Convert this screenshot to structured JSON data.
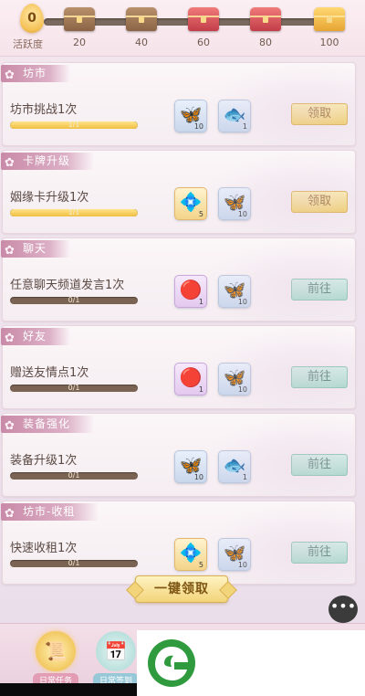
{
  "activity": {
    "label": "活跃度",
    "value": "0",
    "progress": 0,
    "milestones": [
      "20",
      "40",
      "60",
      "80",
      "100"
    ],
    "chest_types": [
      "wood",
      "wood",
      "red",
      "red",
      "gold"
    ]
  },
  "tasks": [
    {
      "category": "坊市",
      "title": "坊市挑战1次",
      "progress_text": "1/1",
      "progress": 1,
      "rewards": [
        {
          "icon": "butterfly-icon",
          "style": "blue",
          "glyph": "🦋",
          "qty": "10"
        },
        {
          "icon": "fish-icon",
          "style": "blue",
          "glyph": "🐟",
          "qty": "1"
        }
      ],
      "button": "领取",
      "button_type": "claim"
    },
    {
      "category": "卡牌升级",
      "title": "姻缘卡升级1次",
      "progress_text": "1/1",
      "progress": 1,
      "rewards": [
        {
          "icon": "gem-icon",
          "style": "gold",
          "glyph": "💠",
          "qty": "5"
        },
        {
          "icon": "butterfly-icon",
          "style": "blue",
          "glyph": "🦋",
          "qty": "10"
        }
      ],
      "button": "领取",
      "button_type": "claim"
    },
    {
      "category": "聊天",
      "title": "任意聊天频道发言1次",
      "progress_text": "0/1",
      "progress": 0,
      "rewards": [
        {
          "icon": "red-orb-icon",
          "style": "purple",
          "glyph": "🔴",
          "qty": "1"
        },
        {
          "icon": "butterfly-icon",
          "style": "blue",
          "glyph": "🦋",
          "qty": "10"
        }
      ],
      "button": "前往",
      "button_type": "goto"
    },
    {
      "category": "好友",
      "title": "赠送友情点1次",
      "progress_text": "0/1",
      "progress": 0,
      "rewards": [
        {
          "icon": "red-orb-icon",
          "style": "purple",
          "glyph": "🔴",
          "qty": "1"
        },
        {
          "icon": "butterfly-icon",
          "style": "blue",
          "glyph": "🦋",
          "qty": "10"
        }
      ],
      "button": "前往",
      "button_type": "goto"
    },
    {
      "category": "装备强化",
      "title": "装备升级1次",
      "progress_text": "0/1",
      "progress": 0,
      "rewards": [
        {
          "icon": "butterfly-icon",
          "style": "blue",
          "glyph": "🦋",
          "qty": "10"
        },
        {
          "icon": "fish-icon",
          "style": "blue",
          "glyph": "🐟",
          "qty": "1"
        }
      ],
      "button": "前往",
      "button_type": "goto"
    },
    {
      "category": "坊市-收租",
      "title": "快速收租1次",
      "progress_text": "0/1",
      "progress": 0,
      "rewards": [
        {
          "icon": "gem-icon",
          "style": "gold",
          "glyph": "💠",
          "qty": "5"
        },
        {
          "icon": "butterfly-icon",
          "style": "blue",
          "glyph": "🦋",
          "qty": "10"
        }
      ],
      "button": "前往",
      "button_type": "goto"
    }
  ],
  "claim_all": "一键领取",
  "chat_icon": "chat-bubble-icon",
  "tabs": [
    {
      "label": "日常任务",
      "icon": "scroll-icon",
      "active": true
    },
    {
      "label": "日常签到",
      "icon": "calendar-icon",
      "active": false
    }
  ]
}
